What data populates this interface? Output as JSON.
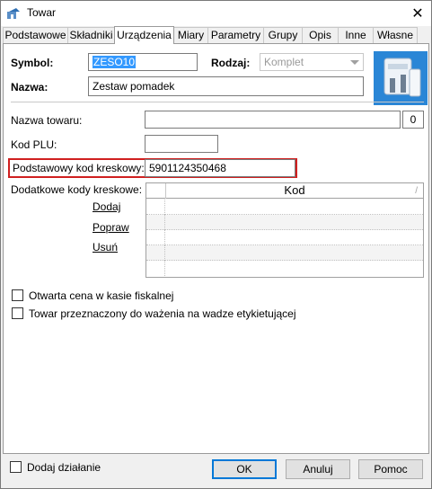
{
  "window": {
    "title": "Towar"
  },
  "tabs": [
    {
      "label": "Podstawowe",
      "active": false
    },
    {
      "label": "Składniki",
      "active": false
    },
    {
      "label": "Urządzenia",
      "active": true
    },
    {
      "label": "Miary",
      "active": false
    },
    {
      "label": "Parametry",
      "active": false
    },
    {
      "label": "Grupy",
      "active": false
    },
    {
      "label": "Opis",
      "active": false
    },
    {
      "label": "Inne",
      "active": false
    },
    {
      "label": "Własne",
      "active": false
    }
  ],
  "header": {
    "symbol_label": "Symbol:",
    "symbol_value": "ZESO10",
    "rodzaj_label": "Rodzaj:",
    "rodzaj_value": "Komplet",
    "nazwa_label": "Nazwa:",
    "nazwa_value": "Zestaw pomadek"
  },
  "form": {
    "nazwa_towaru_label": "Nazwa towaru:",
    "nazwa_towaru_value": "",
    "nazwa_towaru_count": "0",
    "kod_plu_label": "Kod PLU:",
    "kod_plu_value": "",
    "kod_kreskowy_label": "Podstawowy kod kreskowy:",
    "kod_kreskowy_value": "5901124350468",
    "dodatkowe_label": "Dodatkowe kody kreskowe:"
  },
  "grid": {
    "column_header": "Kod",
    "rows": 5
  },
  "links": {
    "dodaj": "Dodaj",
    "popraw": "Popraw",
    "usun": "Usuń"
  },
  "checkboxes": {
    "otwarta_cena": "Otwarta cena w kasie fiskalnej",
    "wazenie": "Towar przeznaczony do ważenia na wadze etykietującej",
    "dodaj_dzialanie": "Dodaj działanie"
  },
  "buttons": {
    "ok": "OK",
    "anuluj": "Anuluj",
    "pomoc": "Pomoc"
  },
  "colors": {
    "highlight_border": "#d02020",
    "selection": "#3399ff"
  }
}
